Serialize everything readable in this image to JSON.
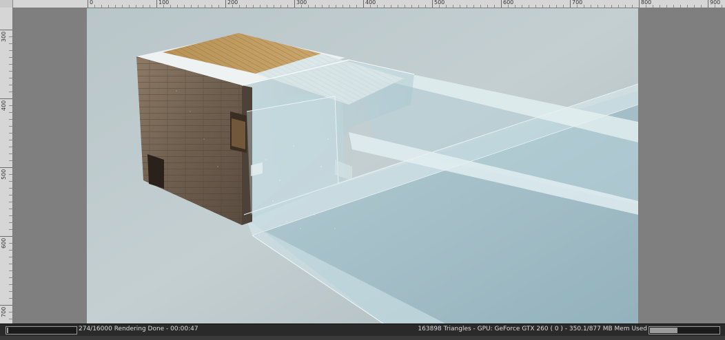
{
  "ruler": {
    "top_labels": [
      "0",
      "100",
      "200",
      "300",
      "400",
      "500",
      "600",
      "700",
      "800",
      "900"
    ],
    "left_labels": [
      "300",
      "400",
      "500",
      "600",
      "700"
    ]
  },
  "render": {
    "image_description_icon": "architectural-render-icon"
  },
  "status": {
    "progress_text": "274/16000 Rendering Done - 00:00:47",
    "info_text": "163898 Triangles - GPU: GeForce GTX 260 ( 0 ) - 350.1/877 MB Mem Used",
    "render_progress_fraction": 0.017,
    "memory_used_fraction": 0.4
  },
  "colors": {
    "viewport_bg": "#7f7f7f",
    "ruler_bg": "#d6d6d6",
    "status_bg": "#2a2a2a"
  }
}
